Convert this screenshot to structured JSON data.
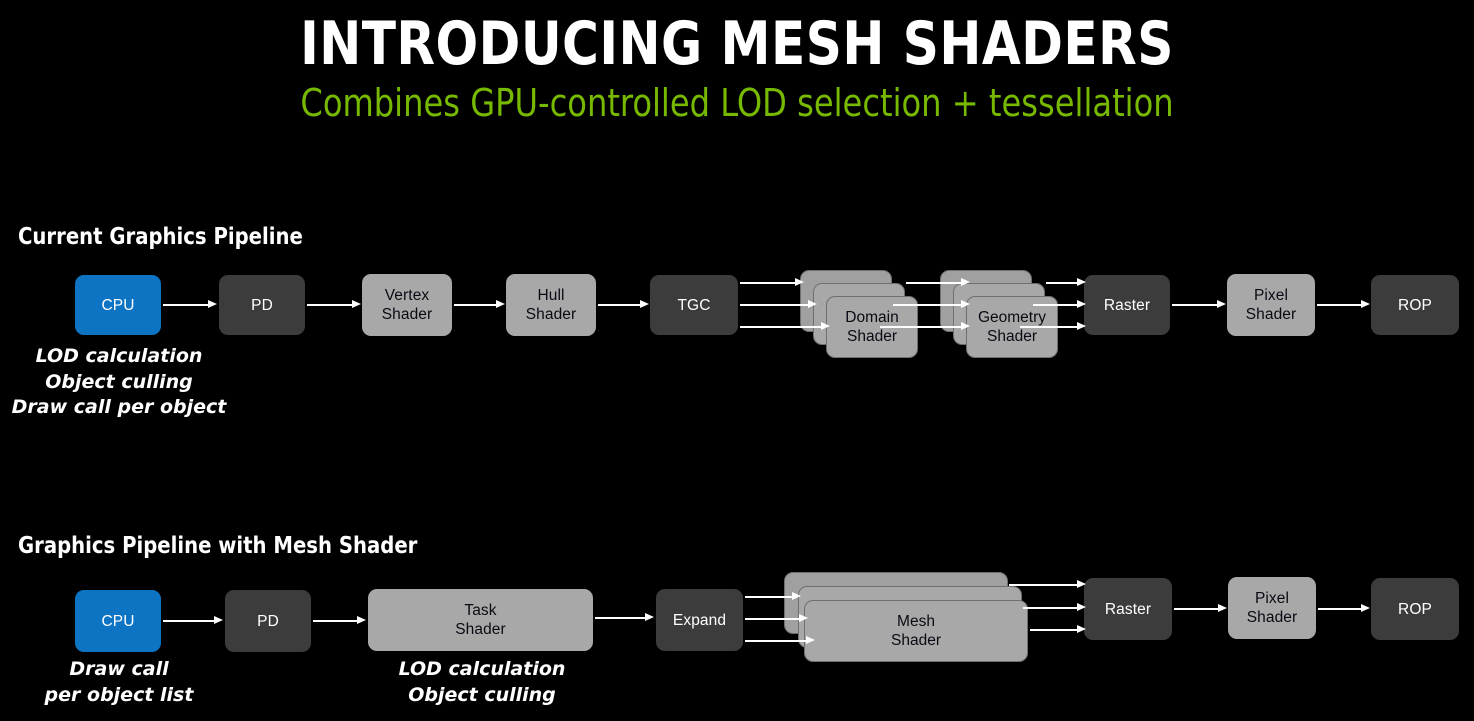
{
  "header": {
    "title": "INTRODUCING MESH SHADERS",
    "subtitle": "Combines GPU-controlled LOD selection + tessellation",
    "title_color": "#ffffff",
    "subtitle_color": "#76b900"
  },
  "colors": {
    "background": "#000000",
    "cpu_blue": "#0d74c4",
    "fixed_function_gray": "#3c3c3c",
    "programmable_gray": "#a8a8a8",
    "arrow_white": "#ffffff",
    "nvidia_green": "#76b900"
  },
  "sections": [
    {
      "id": "current",
      "heading": "Current Graphics Pipeline",
      "nodes": [
        {
          "name": "cpu",
          "label": "CPU",
          "style": "blue"
        },
        {
          "name": "pd",
          "label": "PD",
          "style": "dark"
        },
        {
          "name": "vertex-shader",
          "label": "Vertex\nShader",
          "style": "light"
        },
        {
          "name": "hull-shader",
          "label": "Hull\nShader",
          "style": "light"
        },
        {
          "name": "tgc",
          "label": "TGC",
          "style": "dark"
        },
        {
          "name": "domain-shader",
          "label": "Domain\nShader",
          "style": "stack"
        },
        {
          "name": "geometry-shader",
          "label": "Geometry\nShader",
          "style": "stack"
        },
        {
          "name": "raster",
          "label": "Raster",
          "style": "dark"
        },
        {
          "name": "pixel-shader",
          "label": "Pixel\nShader",
          "style": "light"
        },
        {
          "name": "rop",
          "label": "ROP",
          "style": "dark"
        }
      ],
      "captions": [
        {
          "name": "cpu-caption",
          "text": "LOD calculation\nObject culling\nDraw call per object"
        }
      ]
    },
    {
      "id": "mesh",
      "heading": "Graphics Pipeline with Mesh Shader",
      "nodes": [
        {
          "name": "cpu",
          "label": "CPU",
          "style": "blue"
        },
        {
          "name": "pd",
          "label": "PD",
          "style": "dark"
        },
        {
          "name": "task-shader",
          "label": "Task\nShader",
          "style": "light"
        },
        {
          "name": "expand",
          "label": "Expand",
          "style": "dark"
        },
        {
          "name": "mesh-shader",
          "label": "Mesh\nShader",
          "style": "stack"
        },
        {
          "name": "raster",
          "label": "Raster",
          "style": "dark"
        },
        {
          "name": "pixel-shader",
          "label": "Pixel\nShader",
          "style": "light"
        },
        {
          "name": "rop",
          "label": "ROP",
          "style": "dark"
        }
      ],
      "captions": [
        {
          "name": "cpu-caption",
          "text": "Draw call\nper object list"
        },
        {
          "name": "task-caption",
          "text": "LOD calculation\nObject culling"
        }
      ]
    }
  ]
}
